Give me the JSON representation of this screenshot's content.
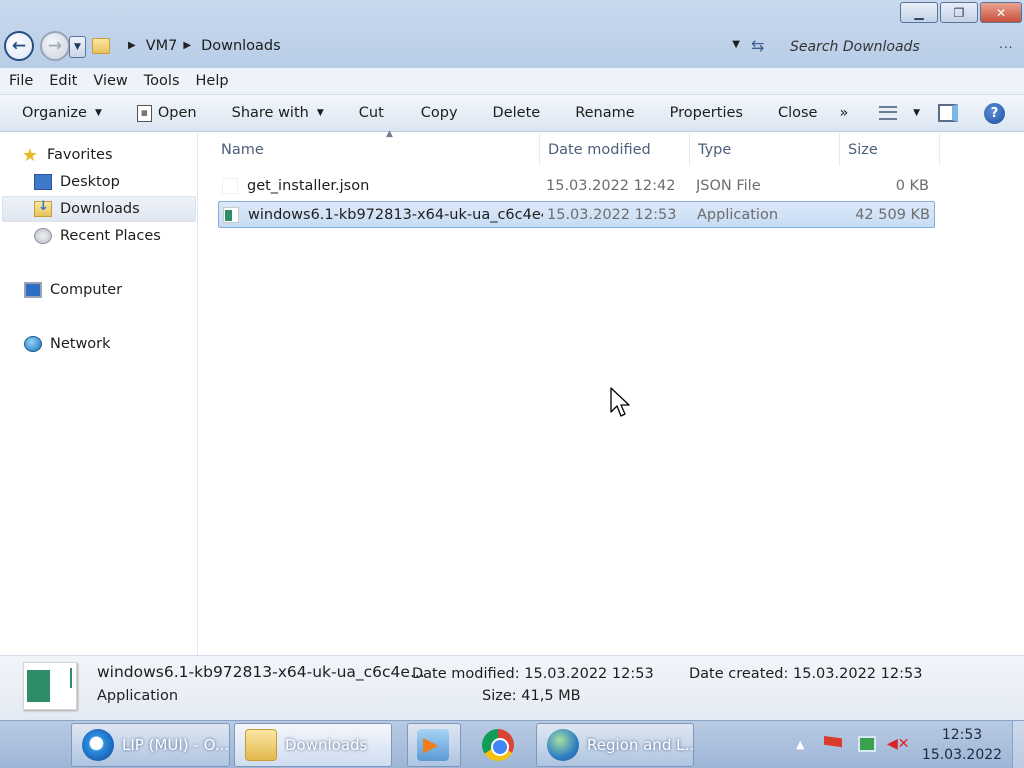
{
  "window": {
    "caption_buttons": [
      "minimize",
      "restore",
      "close"
    ]
  },
  "address": {
    "crumbs": [
      "VM7",
      "Downloads"
    ],
    "search_placeholder": "Search Downloads"
  },
  "menu": [
    "File",
    "Edit",
    "View",
    "Tools",
    "Help"
  ],
  "toolbar": {
    "organize": "Organize",
    "open": "Open",
    "share_with": "Share with",
    "cut": "Cut",
    "copy": "Copy",
    "delete": "Delete",
    "rename": "Rename",
    "properties": "Properties",
    "close": "Close",
    "more": "»"
  },
  "nav": {
    "favorites": "Favorites",
    "desktop": "Desktop",
    "downloads": "Downloads",
    "recent_places": "Recent Places",
    "computer": "Computer",
    "network": "Network",
    "selected": "downloads"
  },
  "columns": [
    "Name",
    "Date modified",
    "Type",
    "Size"
  ],
  "files": [
    {
      "name": "get_installer.json",
      "date": "15.03.2022 12:42",
      "type": "JSON File",
      "size": "0 KB",
      "icon": "json-file-icon",
      "selected": false
    },
    {
      "name": "windows6.1-kb972813-x64-uk-ua_c6c4e4...",
      "date": "15.03.2022 12:53",
      "type": "Application",
      "size": "42 509 KB",
      "icon": "application-icon",
      "selected": true
    }
  ],
  "details": {
    "name": "windows6.1-kb972813-x64-uk-ua_c6c4e...",
    "type": "Application",
    "date_modified_label": "Date modified:",
    "date_modified": "15.03.2022 12:53",
    "date_created_label": "Date created:",
    "date_created": "15.03.2022 12:53",
    "size_label": "Size:",
    "size": "41,5 MB"
  },
  "taskbar": {
    "items": [
      {
        "label": "LIP (MUI) - O...",
        "icon": "internet-explorer-icon"
      },
      {
        "label": "Downloads",
        "icon": "folder-icon",
        "active": true
      },
      {
        "label": "",
        "icon": "media-player-icon"
      },
      {
        "label": "",
        "icon": "chrome-icon"
      },
      {
        "label": "Region and L...",
        "icon": "region-globe-icon"
      }
    ],
    "time": "12:53",
    "date": "15.03.2022"
  }
}
